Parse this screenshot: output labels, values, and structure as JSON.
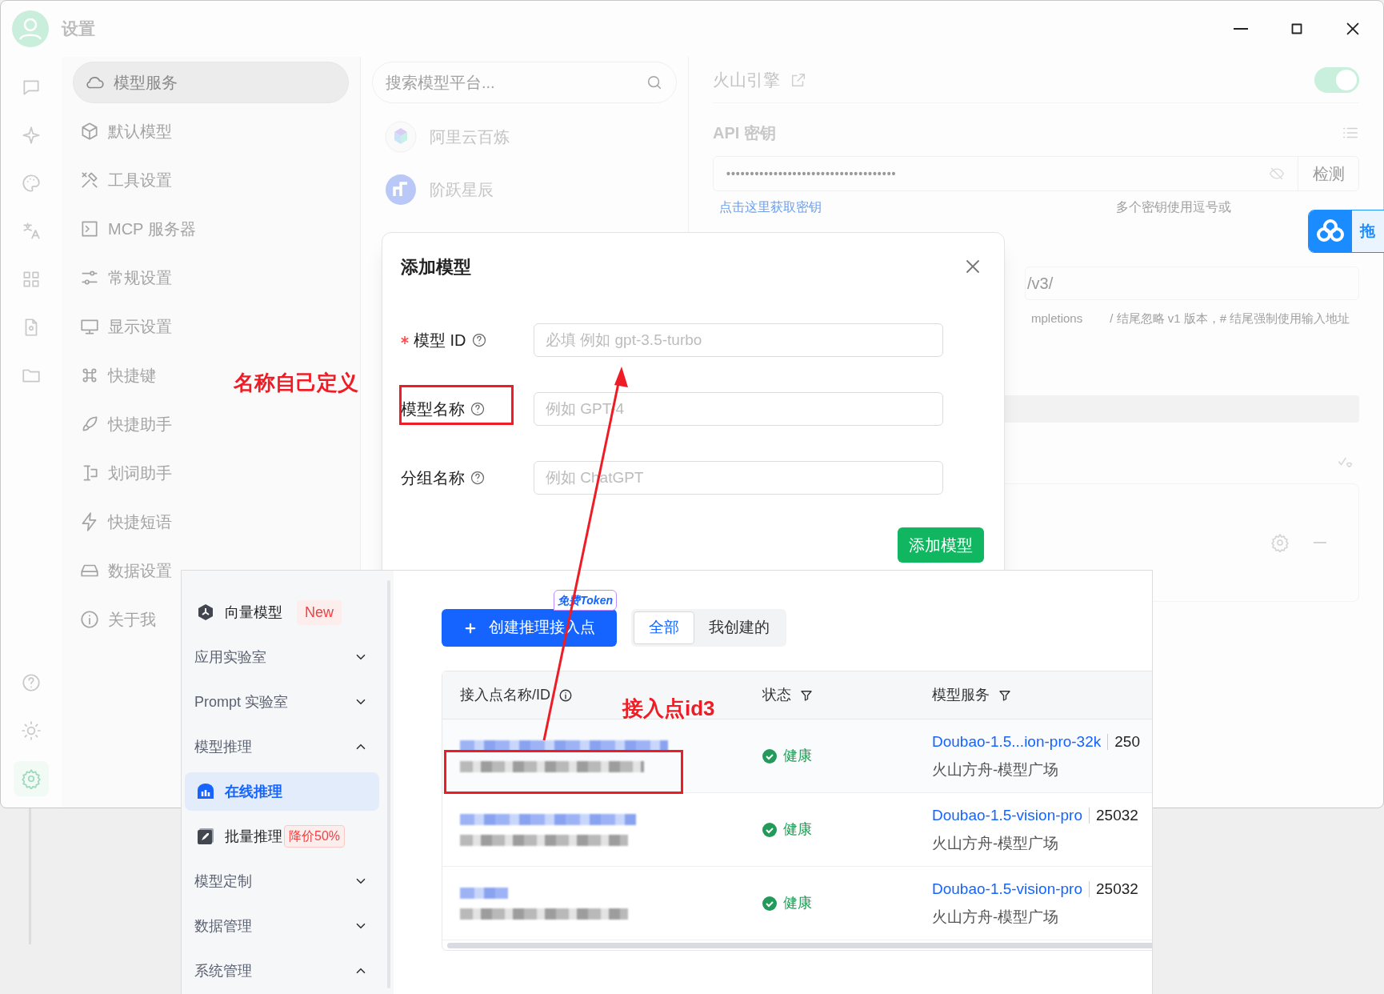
{
  "window": {
    "title": "设置"
  },
  "rail": [
    {
      "selected": false
    },
    {
      "selected": false
    },
    {
      "selected": false
    },
    {
      "selected": false
    },
    {
      "selected": false
    },
    {
      "selected": false
    },
    {
      "selected": false
    }
  ],
  "rail_bottom": [
    {
      "selected": false
    },
    {
      "selected": false
    },
    {
      "selected": true
    }
  ],
  "settings_nav": [
    {
      "label": "模型服务",
      "selected": true
    },
    {
      "label": "默认模型",
      "selected": false
    },
    {
      "label": "工具设置",
      "selected": false
    },
    {
      "label": "MCP 服务器",
      "selected": false
    },
    {
      "label": "常规设置",
      "selected": false
    },
    {
      "label": "显示设置",
      "selected": false
    },
    {
      "label": "快捷键",
      "selected": false
    },
    {
      "label": "快捷助手",
      "selected": false
    },
    {
      "label": "划词助手",
      "selected": false
    },
    {
      "label": "快捷短语",
      "selected": false
    },
    {
      "label": "数据设置",
      "selected": false
    },
    {
      "label": "关于我",
      "selected": false
    }
  ],
  "provider_search": {
    "placeholder": "搜索模型平台..."
  },
  "providers": [
    {
      "name": "阿里云百炼"
    },
    {
      "name": "阶跃星辰"
    }
  ],
  "provider_detail": {
    "title": "火山引擎",
    "enabled": true,
    "api_key_heading": "API 密钥",
    "api_key_value": "••••••••••••••••••••••••••••••••••••",
    "check_button": "检测",
    "get_key_link": "点击这里获取密钥",
    "key_hint": "多个密钥使用逗号或",
    "api_host_value": "/v3/",
    "api_host_hint": "mpletions",
    "api_host_note": "/ 结尾忽略 v1 版本，# 结尾强制使用输入地址"
  },
  "floating_widget": {
    "label": "拖"
  },
  "dialog": {
    "title": "添加模型",
    "fields": [
      {
        "label": "模型 ID",
        "required": true,
        "placeholder": "必填 例如 gpt-3.5-turbo"
      },
      {
        "label": "模型名称",
        "required": false,
        "placeholder": "例如 GPT-4"
      },
      {
        "label": "分组名称",
        "required": false,
        "placeholder": "例如 ChatGPT"
      }
    ],
    "submit_button": "添加模型"
  },
  "console": {
    "sidebar": [
      {
        "kind": "item",
        "label": "向量模型",
        "badge": "New",
        "selected": false
      },
      {
        "kind": "group",
        "label": "应用实验室",
        "expanded": false
      },
      {
        "kind": "group",
        "label": "Prompt 实验室",
        "expanded": false
      },
      {
        "kind": "group",
        "label": "模型推理",
        "expanded": true
      },
      {
        "kind": "item",
        "label": "在线推理",
        "selected": true
      },
      {
        "kind": "item",
        "label": "批量推理",
        "badge": "降价50%",
        "selected": false
      },
      {
        "kind": "group",
        "label": "模型定制",
        "expanded": false
      },
      {
        "kind": "group",
        "label": "数据管理",
        "expanded": false
      },
      {
        "kind": "group",
        "label": "系统管理",
        "expanded": true
      }
    ],
    "create_button": "创建推理接入点",
    "promo_badge": "免费Token",
    "filter_tabs": [
      {
        "label": "全部",
        "selected": true
      },
      {
        "label": "我创建的",
        "selected": false
      }
    ],
    "table": {
      "columns": [
        "接入点名称/ID",
        "状态",
        "模型服务"
      ],
      "rows": [
        {
          "status": "健康",
          "model": "Doubao-1.5...ion-pro-32k",
          "version": "250",
          "source": "火山方舟-模型广场"
        },
        {
          "status": "健康",
          "model": "Doubao-1.5-vision-pro",
          "version": "25032",
          "source": "火山方舟-模型广场"
        },
        {
          "status": "健康",
          "model": "Doubao-1.5-vision-pro",
          "version": "25032",
          "source": "火山方舟-模型广场"
        }
      ]
    }
  },
  "annotations": {
    "label_note": "名称自己定义",
    "row_note": "接入点id3"
  }
}
